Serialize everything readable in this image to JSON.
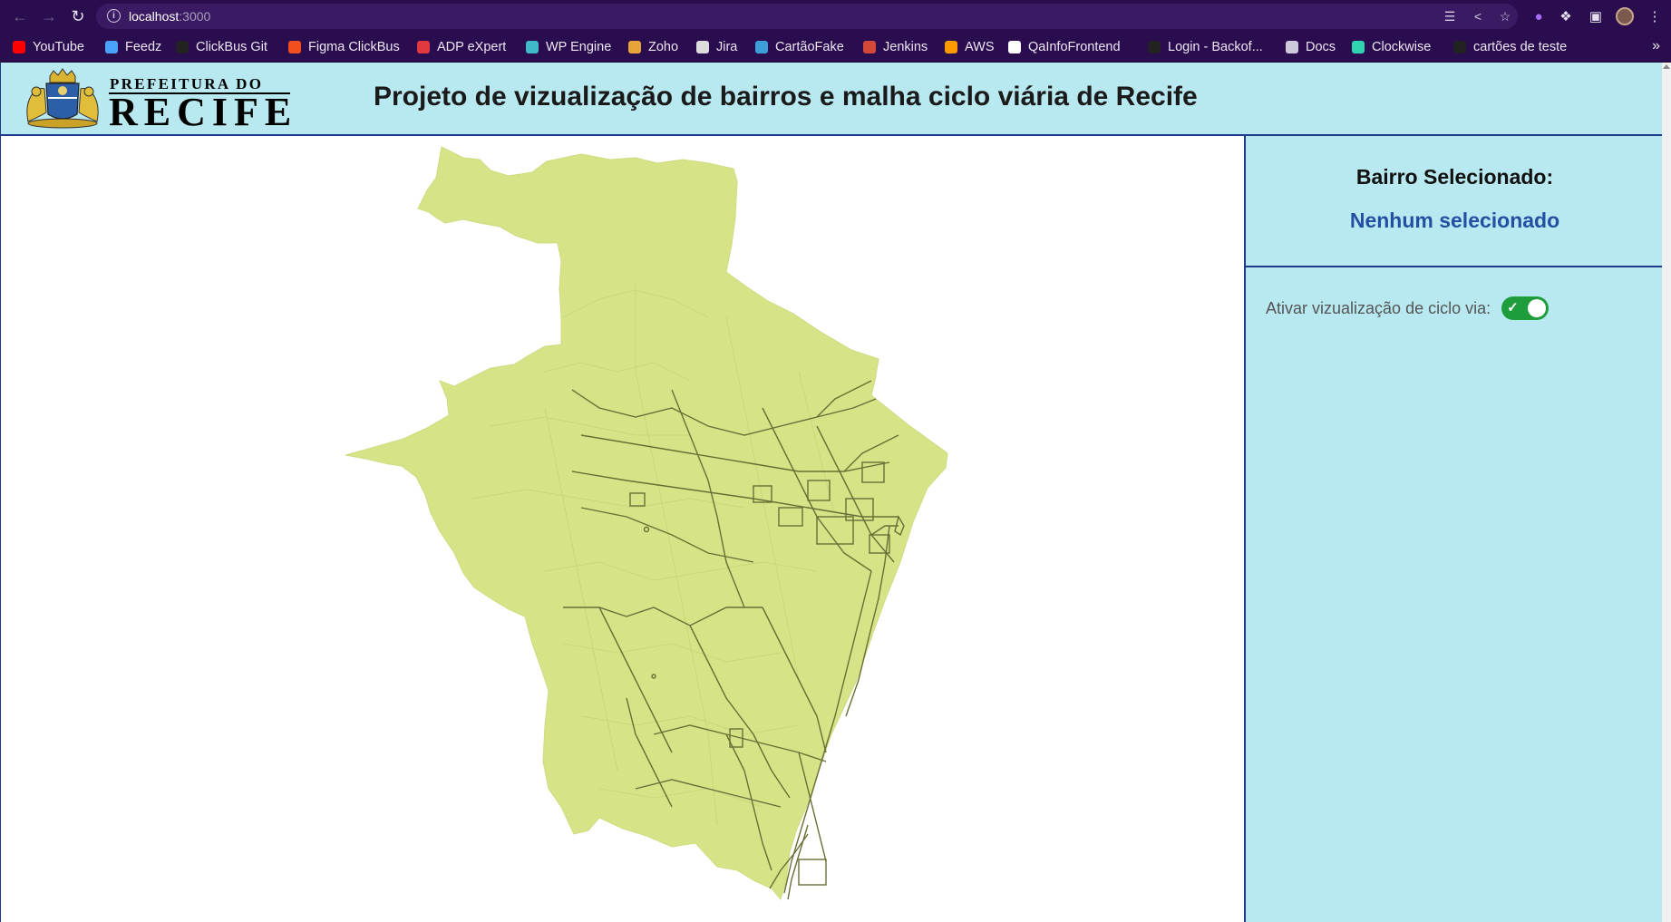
{
  "browser": {
    "url_host": "localhost",
    "url_port": ":3000",
    "bookmarks": [
      {
        "label": "YouTube",
        "icon": "youtube-icon",
        "color": "#ff0000"
      },
      {
        "label": "Feedz",
        "icon": "feedz-icon",
        "color": "#4aa3ff"
      },
      {
        "label": "ClickBus Git",
        "icon": "github-icon",
        "color": "#222222"
      },
      {
        "label": "Figma ClickBus",
        "icon": "figma-icon",
        "color": "#f24e1e"
      },
      {
        "label": "ADP eXpert",
        "icon": "adp-icon",
        "color": "#e03a3e"
      },
      {
        "label": "WP Engine",
        "icon": "wpengine-icon",
        "color": "#40bac8"
      },
      {
        "label": "Zoho",
        "icon": "zoho-icon",
        "color": "#e9a33b"
      },
      {
        "label": "Jira",
        "icon": "globe-icon",
        "color": "#dddddd"
      },
      {
        "label": "CartãoFake",
        "icon": "card-icon",
        "color": "#3b9fd8"
      },
      {
        "label": "Jenkins",
        "icon": "jenkins-icon",
        "color": "#d24939"
      },
      {
        "label": "AWS",
        "icon": "aws-icon",
        "color": "#ff9900"
      },
      {
        "label": "QaInfoFrontend",
        "icon": "angular-icon",
        "color": "#ffffff"
      },
      {
        "label": "Login - Backof...",
        "icon": "github-icon",
        "color": "#222222"
      },
      {
        "label": "Docs",
        "icon": "folder-icon",
        "color": "#cfc8da"
      },
      {
        "label": "Clockwise",
        "icon": "clockwise-icon",
        "color": "#2fd3b0"
      },
      {
        "label": "cartões de teste",
        "icon": "github-icon",
        "color": "#222222"
      }
    ]
  },
  "header": {
    "logo_top": "PREFEITURA DO",
    "logo_main": "RECIFE",
    "title": "Projeto de vizualização de bairros e malha ciclo viária de Recife"
  },
  "side_panel": {
    "selected_title": "Bairro Selecionado:",
    "selected_value": "Nenhum selecionado",
    "toggle_label": "Ativar vizualização de ciclo via:",
    "toggle_on": true
  },
  "colors": {
    "header_bg": "#b8e8f0",
    "border": "#1e3a8a",
    "map_fill": "#d6e387",
    "cycle_lane": "#6b6e35",
    "selected_text": "#2350a2",
    "toggle_on": "#1e9e3a"
  }
}
